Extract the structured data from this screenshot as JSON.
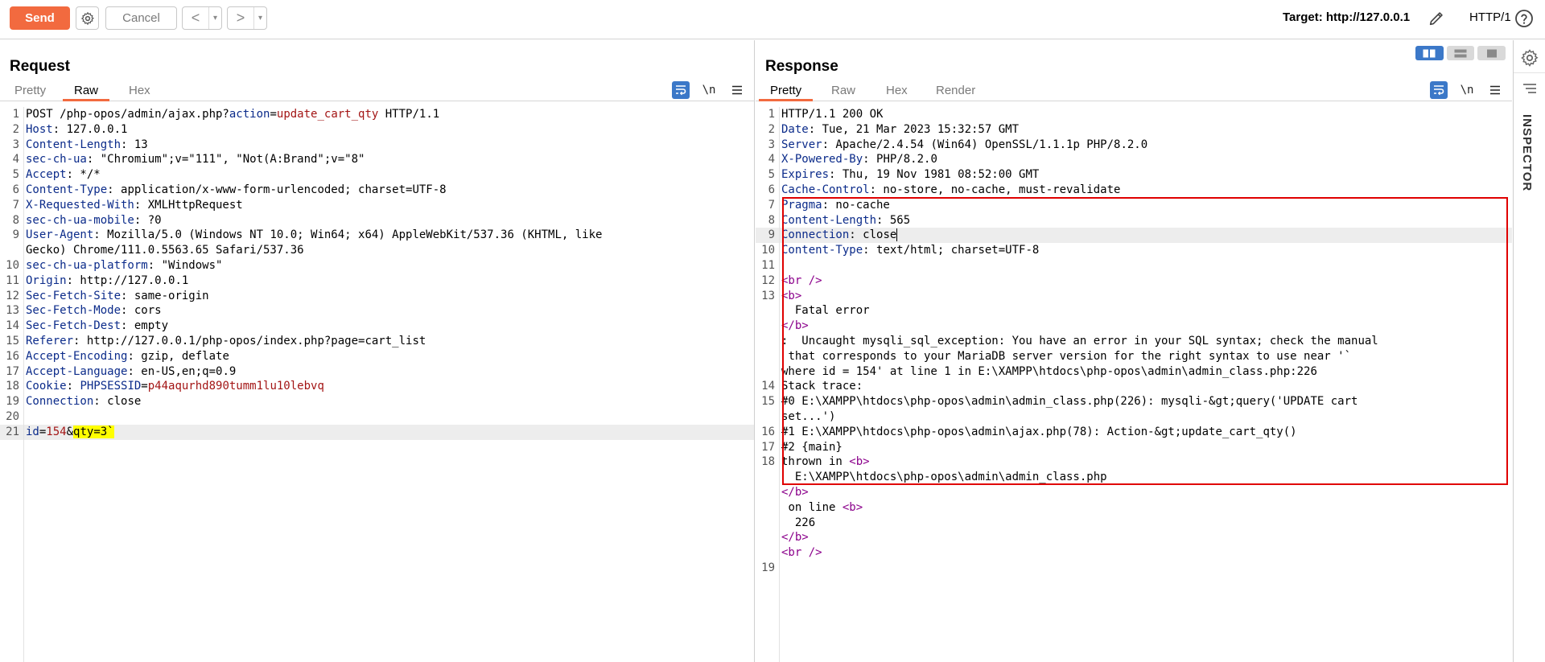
{
  "toolbar": {
    "send_label": "Send",
    "cancel_label": "Cancel",
    "back_label": "<",
    "forward_label": ">",
    "dropdown_label": "▾",
    "target_label": "Target: http://127.0.0.1",
    "protocol_label": "HTTP/1"
  },
  "request": {
    "title": "Request",
    "tabs": [
      "Pretty",
      "Raw",
      "Hex"
    ],
    "active_tab": "Raw",
    "lines": [
      {
        "n": "1",
        "parts": [
          [
            "POST /php-opos/admin/ajax.php?",
            "hval"
          ],
          [
            "action",
            "param"
          ],
          [
            "=",
            "hval"
          ],
          [
            "update_cart_qty",
            "pval"
          ],
          [
            " HTTP/1.1",
            "hval"
          ]
        ]
      },
      {
        "n": "2",
        "parts": [
          [
            "Host",
            "hdr"
          ],
          [
            ": 127.0.0.1",
            "hval"
          ]
        ]
      },
      {
        "n": "3",
        "parts": [
          [
            "Content-Length",
            "hdr"
          ],
          [
            ": 13",
            "hval"
          ]
        ]
      },
      {
        "n": "4",
        "parts": [
          [
            "sec-ch-ua",
            "hdr"
          ],
          [
            ": \"Chromium\";v=\"111\", \"Not(A:Brand\";v=\"8\"",
            "hval"
          ]
        ]
      },
      {
        "n": "5",
        "parts": [
          [
            "Accept",
            "hdr"
          ],
          [
            ": */*",
            "hval"
          ]
        ]
      },
      {
        "n": "6",
        "parts": [
          [
            "Content-Type",
            "hdr"
          ],
          [
            ": application/x-www-form-urlencoded; charset=UTF-8",
            "hval"
          ]
        ]
      },
      {
        "n": "7",
        "parts": [
          [
            "X-Requested-With",
            "hdr"
          ],
          [
            ": XMLHttpRequest",
            "hval"
          ]
        ]
      },
      {
        "n": "8",
        "parts": [
          [
            "sec-ch-ua-mobile",
            "hdr"
          ],
          [
            ": ?0",
            "hval"
          ]
        ]
      },
      {
        "n": "9",
        "parts": [
          [
            "User-Agent",
            "hdr"
          ],
          [
            ": Mozilla/5.0 (Windows NT 10.0; Win64; x64) AppleWebKit/537.36 (KHTML, like",
            "hval"
          ]
        ]
      },
      {
        "n": "",
        "parts": [
          [
            "Gecko) Chrome/111.0.5563.65 Safari/537.36",
            "hval"
          ]
        ]
      },
      {
        "n": "10",
        "parts": [
          [
            "sec-ch-ua-platform",
            "hdr"
          ],
          [
            ": \"Windows\"",
            "hval"
          ]
        ]
      },
      {
        "n": "11",
        "parts": [
          [
            "Origin",
            "hdr"
          ],
          [
            ": http://127.0.0.1",
            "hval"
          ]
        ]
      },
      {
        "n": "12",
        "parts": [
          [
            "Sec-Fetch-Site",
            "hdr"
          ],
          [
            ": same-origin",
            "hval"
          ]
        ]
      },
      {
        "n": "13",
        "parts": [
          [
            "Sec-Fetch-Mode",
            "hdr"
          ],
          [
            ": cors",
            "hval"
          ]
        ]
      },
      {
        "n": "14",
        "parts": [
          [
            "Sec-Fetch-Dest",
            "hdr"
          ],
          [
            ": empty",
            "hval"
          ]
        ]
      },
      {
        "n": "15",
        "parts": [
          [
            "Referer",
            "hdr"
          ],
          [
            ": http://127.0.0.1/php-opos/index.php?page=cart_list",
            "hval"
          ]
        ]
      },
      {
        "n": "16",
        "parts": [
          [
            "Accept-Encoding",
            "hdr"
          ],
          [
            ": gzip, deflate",
            "hval"
          ]
        ]
      },
      {
        "n": "17",
        "parts": [
          [
            "Accept-Language",
            "hdr"
          ],
          [
            ": en-US,en;q=0.9",
            "hval"
          ]
        ]
      },
      {
        "n": "18",
        "parts": [
          [
            "Cookie",
            "hdr"
          ],
          [
            ": ",
            "hval"
          ],
          [
            "PHPSESSID",
            "param"
          ],
          [
            "=",
            "hval"
          ],
          [
            "p44aqurhd890tumm1lu10lebvq",
            "pval"
          ]
        ]
      },
      {
        "n": "19",
        "parts": [
          [
            "Connection",
            "hdr"
          ],
          [
            ": close",
            "hval"
          ]
        ]
      },
      {
        "n": "20",
        "parts": []
      },
      {
        "n": "21",
        "hl": true,
        "parts": [
          [
            "id",
            "param"
          ],
          [
            "=",
            "hval"
          ],
          [
            "154",
            "pval"
          ],
          [
            "&",
            "hval"
          ],
          [
            "qty=3`",
            "ylw"
          ]
        ]
      }
    ]
  },
  "response": {
    "title": "Response",
    "tabs": [
      "Pretty",
      "Raw",
      "Hex",
      "Render"
    ],
    "active_tab": "Pretty",
    "lines": [
      {
        "n": "1",
        "parts": [
          [
            "HTTP/1.1 200 OK",
            "hval"
          ]
        ]
      },
      {
        "n": "2",
        "parts": [
          [
            "Date",
            "hdr"
          ],
          [
            ": Tue, 21 Mar 2023 15:32:57 GMT",
            "hval"
          ]
        ]
      },
      {
        "n": "3",
        "parts": [
          [
            "Server",
            "hdr"
          ],
          [
            ": Apache/2.4.54 (Win64) OpenSSL/1.1.1p PHP/8.2.0",
            "hval"
          ]
        ]
      },
      {
        "n": "4",
        "parts": [
          [
            "X-Powered-By",
            "hdr"
          ],
          [
            ": PHP/8.2.0",
            "hval"
          ]
        ]
      },
      {
        "n": "5",
        "parts": [
          [
            "Expires",
            "hdr"
          ],
          [
            ": Thu, 19 Nov 1981 08:52:00 GMT",
            "hval"
          ]
        ]
      },
      {
        "n": "6",
        "parts": [
          [
            "Cache-Control",
            "hdr"
          ],
          [
            ": no-store, no-cache, must-revalidate",
            "hval"
          ]
        ]
      },
      {
        "n": "7",
        "parts": [
          [
            "Pragma",
            "hdr"
          ],
          [
            ": no-cache",
            "hval"
          ]
        ]
      },
      {
        "n": "8",
        "parts": [
          [
            "Content-Length",
            "hdr"
          ],
          [
            ": 565",
            "hval"
          ]
        ]
      },
      {
        "n": "9",
        "hl": true,
        "cursor": true,
        "parts": [
          [
            "Connection",
            "hdr"
          ],
          [
            ": close",
            "hval"
          ]
        ]
      },
      {
        "n": "10",
        "parts": [
          [
            "Content-Type",
            "hdr"
          ],
          [
            ": text/html; charset=UTF-8",
            "hval"
          ]
        ]
      },
      {
        "n": "11",
        "parts": []
      },
      {
        "n": "12",
        "parts": [
          [
            "<br />",
            "tag"
          ]
        ]
      },
      {
        "n": "13",
        "parts": [
          [
            "<b>",
            "tag"
          ]
        ]
      },
      {
        "n": "",
        "parts": [
          [
            "  Fatal error",
            "hval"
          ]
        ]
      },
      {
        "n": "",
        "parts": [
          [
            "</b>",
            "tag"
          ]
        ]
      },
      {
        "n": "",
        "parts": [
          [
            ":  Uncaught mysqli_sql_exception: You have an error in your SQL syntax; check the manual",
            "hval"
          ]
        ]
      },
      {
        "n": "",
        "parts": [
          [
            " that corresponds to your MariaDB server version for the right syntax to use near '`",
            "hval"
          ]
        ]
      },
      {
        "n": "",
        "parts": [
          [
            "where id = 154' at line 1 in E:\\XAMPP\\htdocs\\php-opos\\admin\\admin_class.php:226",
            "hval"
          ]
        ]
      },
      {
        "n": "14",
        "parts": [
          [
            "Stack trace:",
            "hval"
          ]
        ]
      },
      {
        "n": "15",
        "parts": [
          [
            "#0 E:\\XAMPP\\htdocs\\php-opos\\admin\\admin_class.php(226): mysqli-&gt;query('UPDATE cart",
            "hval"
          ]
        ]
      },
      {
        "n": "",
        "parts": [
          [
            "set...')",
            "hval"
          ]
        ]
      },
      {
        "n": "16",
        "parts": [
          [
            "#1 E:\\XAMPP\\htdocs\\php-opos\\admin\\ajax.php(78): Action-&gt;update_cart_qty()",
            "hval"
          ]
        ]
      },
      {
        "n": "17",
        "parts": [
          [
            "#2 {main}",
            "hval"
          ]
        ]
      },
      {
        "n": "18",
        "parts": [
          [
            "thrown in ",
            "hval"
          ],
          [
            "<b>",
            "tag"
          ]
        ]
      },
      {
        "n": "",
        "parts": [
          [
            "  E:\\XAMPP\\htdocs\\php-opos\\admin\\admin_class.php",
            "hval"
          ]
        ]
      },
      {
        "n": "",
        "parts": [
          [
            "</b>",
            "tag"
          ]
        ]
      },
      {
        "n": "",
        "parts": [
          [
            " on line ",
            "hval"
          ],
          [
            "<b>",
            "tag"
          ]
        ]
      },
      {
        "n": "",
        "parts": [
          [
            "  226",
            "hval"
          ]
        ]
      },
      {
        "n": "",
        "parts": [
          [
            "</b>",
            "tag"
          ]
        ]
      },
      {
        "n": "",
        "parts": [
          [
            "<br />",
            "tag"
          ]
        ]
      },
      {
        "n": "19",
        "parts": []
      }
    ]
  },
  "inspector": {
    "label": "INSPECTOR"
  },
  "colors": {
    "accent": "#f26a3f",
    "header_name": "#0b2b8a",
    "param_value": "#a31515",
    "html_tag": "#8b008b",
    "highlight": "#ffff00",
    "error_border": "#e00000",
    "toggle_active": "#3b78c8"
  }
}
